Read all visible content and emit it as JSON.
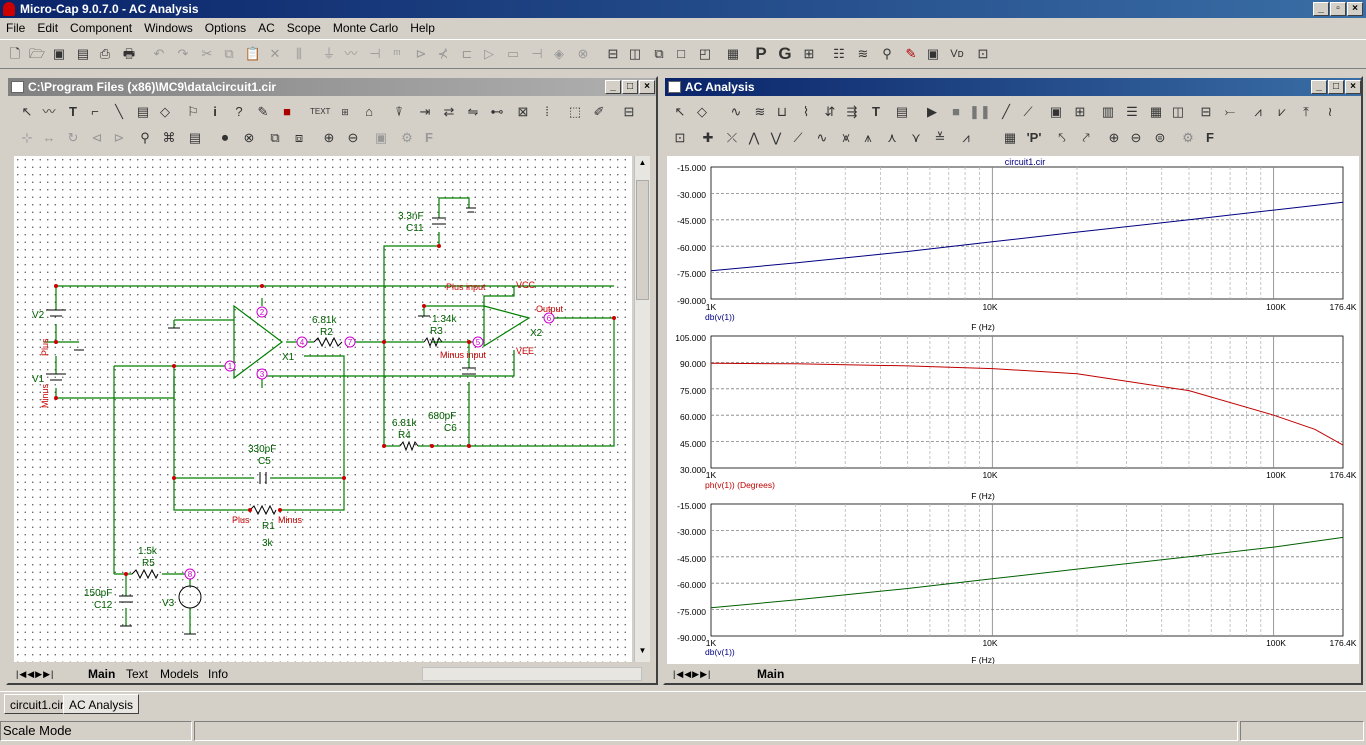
{
  "app": {
    "title": "Micro-Cap 9.0.7.0 - AC Analysis"
  },
  "menu": [
    "File",
    "Edit",
    "Component",
    "Windows",
    "Options",
    "AC",
    "Scope",
    "Monte Carlo",
    "Help"
  ],
  "schematic": {
    "title": "C:\\Program Files (x86)\\MC9\\data\\circuit1.cir",
    "tabs": [
      "Main",
      "Text",
      "Models",
      "Info"
    ],
    "labels": {
      "c11_val": "3.3nF",
      "c11": "C11",
      "r2_val": "6.81k",
      "r2": "R2",
      "x1": "X1",
      "plus_input": "Plus input",
      "vcc": "VCC",
      "output": "Output",
      "x2": "X2",
      "r3_val": "1.34k",
      "r3": "R3",
      "minus_input": "Minus input",
      "vee": "VEE",
      "v2": "V2",
      "v1": "V1",
      "plus": "Plus",
      "minus": "Minus",
      "r4_val": "6.81k",
      "r4": "R4",
      "c6_val": "680pF",
      "c6": "C6",
      "c5_val": "330pF",
      "c5": "C5",
      "r1_plus": "Plus",
      "r1": "R1",
      "r1_minus": "Minus",
      "r1_val": "3k",
      "r5_val": "1.5k",
      "r5": "R5",
      "c12_val": "150pF",
      "c12": "C12",
      "v3": "V3",
      "n1": "1",
      "n2": "2",
      "n3": "3",
      "n4": "4",
      "n5": "5",
      "n6": "6",
      "n7": "7",
      "n8": "8"
    }
  },
  "analysis": {
    "title": "AC Analysis",
    "tab": "Main",
    "plot_title": "circuit1.cir",
    "xticks": [
      "1K",
      "10K",
      "100K",
      "176.4K"
    ],
    "xlabel": "F (Hz)",
    "plot1": {
      "yticks": [
        "-15.000",
        "-30.000",
        "-45.000",
        "-60.000",
        "-75.000",
        "-90.000"
      ],
      "label": "db(v(1))"
    },
    "plot2": {
      "yticks": [
        "105.000",
        "90.000",
        "75.000",
        "60.000",
        "45.000",
        "30.000"
      ],
      "label": "ph(v(1)) (Degrees)"
    },
    "plot3": {
      "yticks": [
        "-15.000",
        "-30.000",
        "-45.000",
        "-60.000",
        "-75.000",
        "-90.000"
      ],
      "label": "db(v(1))"
    }
  },
  "chart_data": [
    {
      "type": "line",
      "title": "circuit1.cir",
      "xlabel": "F (Hz)",
      "ylabel": "",
      "xscale": "log",
      "xlim": [
        1000,
        176400
      ],
      "ylim": [
        -90,
        -15
      ],
      "grid": true,
      "series": [
        {
          "name": "db(v(1))",
          "color": "#000080",
          "x": [
            1000,
            2000,
            5000,
            10000,
            20000,
            50000,
            100000,
            176400
          ],
          "y": [
            -74,
            -69.5,
            -63,
            -57.5,
            -52,
            -45,
            -39.5,
            -35
          ]
        }
      ]
    },
    {
      "type": "line",
      "xlabel": "F (Hz)",
      "ylabel": "",
      "xscale": "log",
      "xlim": [
        1000,
        176400
      ],
      "ylim": [
        30,
        105
      ],
      "grid": true,
      "series": [
        {
          "name": "ph(v(1)) (Degrees)",
          "color": "#c00000",
          "x": [
            1000,
            2000,
            5000,
            10000,
            20000,
            50000,
            100000,
            140000,
            176400
          ],
          "y": [
            89.5,
            89.2,
            88,
            86.5,
            83.5,
            74,
            60,
            52,
            43
          ]
        }
      ]
    },
    {
      "type": "line",
      "xlabel": "F (Hz)",
      "ylabel": "",
      "xscale": "log",
      "xlim": [
        1000,
        176400
      ],
      "ylim": [
        -90,
        -15
      ],
      "grid": true,
      "series": [
        {
          "name": "db(v(1))",
          "color": "#006000",
          "x": [
            1000,
            2000,
            5000,
            10000,
            20000,
            50000,
            100000,
            176400
          ],
          "y": [
            -74,
            -69.5,
            -63,
            -57.5,
            -52,
            -45,
            -39.5,
            -34
          ]
        }
      ]
    }
  ],
  "bottom_tabs": [
    "circuit1.cir",
    "AC Analysis"
  ],
  "status": {
    "mode": "Scale Mode"
  }
}
